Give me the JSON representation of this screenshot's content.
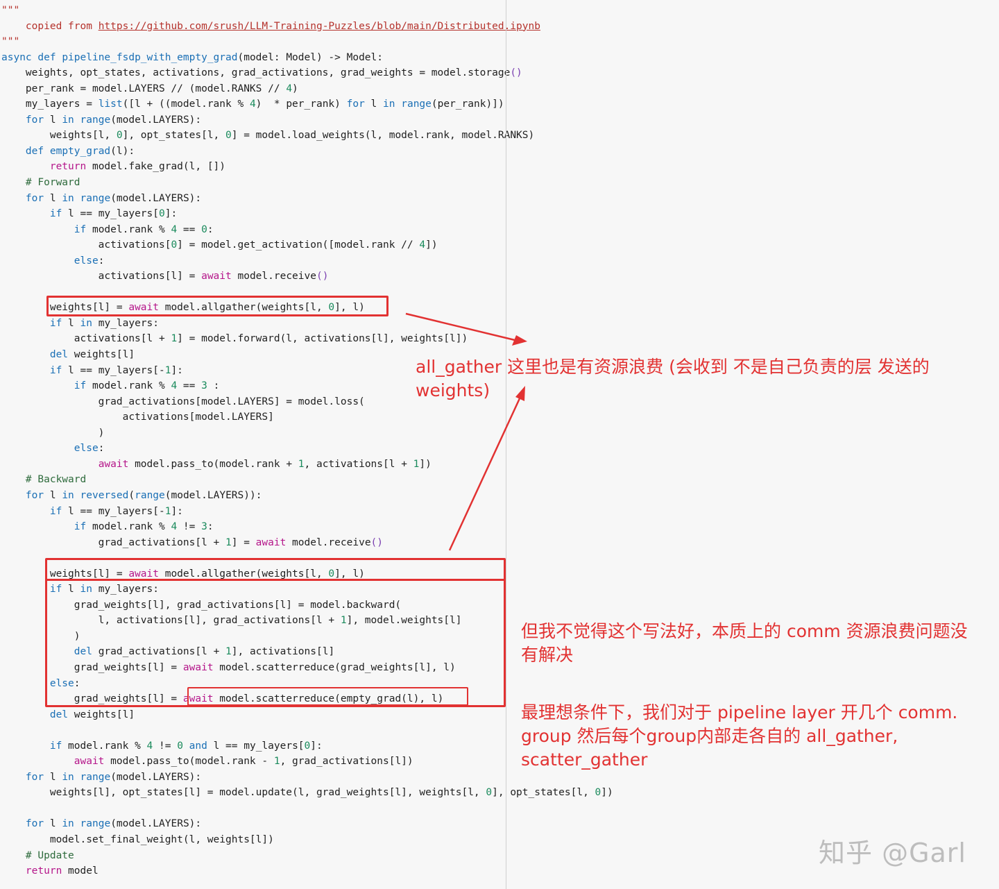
{
  "code": {
    "lines": [
      [
        {
          "t": "\"\"\"",
          "c": "s"
        }
      ],
      [
        {
          "t": "    copied from ",
          "c": "s"
        },
        {
          "t": "https://github.com/srush/LLM-Training-Puzzles/blob/main/Distributed.ipynb",
          "c": "u"
        }
      ],
      [
        {
          "t": "\"\"\"",
          "c": "s"
        }
      ],
      [
        {
          "t": "async def",
          "c": "k"
        },
        {
          "t": " ",
          "c": "x"
        },
        {
          "t": "pipeline_fsdp_with_empty_grad",
          "c": "f"
        },
        {
          "t": "(model: Model) -> Model:",
          "c": "x"
        }
      ],
      [
        {
          "t": "    weights, opt_states, activations, grad_activations, grad_weights = model.storage",
          "c": "x"
        },
        {
          "t": "()",
          "c": "p"
        }
      ],
      [
        {
          "t": "    per_rank = model.LAYERS // (model.RANKS // ",
          "c": "x"
        },
        {
          "t": "4",
          "c": "n"
        },
        {
          "t": ")",
          "c": "x"
        }
      ],
      [
        {
          "t": "    my_layers = ",
          "c": "x"
        },
        {
          "t": "list",
          "c": "b"
        },
        {
          "t": "([l + ((model.rank % ",
          "c": "x"
        },
        {
          "t": "4",
          "c": "n"
        },
        {
          "t": ")  * per_rank) ",
          "c": "x"
        },
        {
          "t": "for",
          "c": "k"
        },
        {
          "t": " l ",
          "c": "x"
        },
        {
          "t": "in",
          "c": "k"
        },
        {
          "t": " ",
          "c": "x"
        },
        {
          "t": "range",
          "c": "b"
        },
        {
          "t": "(per_rank)])",
          "c": "x"
        }
      ],
      [
        {
          "t": "    ",
          "c": "x"
        },
        {
          "t": "for",
          "c": "k"
        },
        {
          "t": " l ",
          "c": "x"
        },
        {
          "t": "in",
          "c": "k"
        },
        {
          "t": " ",
          "c": "x"
        },
        {
          "t": "range",
          "c": "b"
        },
        {
          "t": "(model.LAYERS):",
          "c": "x"
        }
      ],
      [
        {
          "t": "        weights[l, ",
          "c": "x"
        },
        {
          "t": "0",
          "c": "n"
        },
        {
          "t": "], opt_states[l, ",
          "c": "x"
        },
        {
          "t": "0",
          "c": "n"
        },
        {
          "t": "] = model.load_weights(l, model.rank, model.RANKS)",
          "c": "x"
        }
      ],
      [
        {
          "t": "    ",
          "c": "x"
        },
        {
          "t": "def",
          "c": "k"
        },
        {
          "t": " ",
          "c": "x"
        },
        {
          "t": "empty_grad",
          "c": "f"
        },
        {
          "t": "(l):",
          "c": "x"
        }
      ],
      [
        {
          "t": "        ",
          "c": "x"
        },
        {
          "t": "return",
          "c": "m"
        },
        {
          "t": " model.fake_grad(l, [])",
          "c": "x"
        }
      ],
      [
        {
          "t": "    # Forward",
          "c": "c"
        }
      ],
      [
        {
          "t": "    ",
          "c": "x"
        },
        {
          "t": "for",
          "c": "k"
        },
        {
          "t": " l ",
          "c": "x"
        },
        {
          "t": "in",
          "c": "k"
        },
        {
          "t": " ",
          "c": "x"
        },
        {
          "t": "range",
          "c": "b"
        },
        {
          "t": "(model.LAYERS):",
          "c": "x"
        }
      ],
      [
        {
          "t": "        ",
          "c": "x"
        },
        {
          "t": "if",
          "c": "k"
        },
        {
          "t": " l == my_layers[",
          "c": "x"
        },
        {
          "t": "0",
          "c": "n"
        },
        {
          "t": "]:",
          "c": "x"
        }
      ],
      [
        {
          "t": "            ",
          "c": "x"
        },
        {
          "t": "if",
          "c": "k"
        },
        {
          "t": " model.rank % ",
          "c": "x"
        },
        {
          "t": "4",
          "c": "n"
        },
        {
          "t": " == ",
          "c": "x"
        },
        {
          "t": "0",
          "c": "n"
        },
        {
          "t": ":",
          "c": "x"
        }
      ],
      [
        {
          "t": "                activations[",
          "c": "x"
        },
        {
          "t": "0",
          "c": "n"
        },
        {
          "t": "] = model.get_activation([model.rank // ",
          "c": "x"
        },
        {
          "t": "4",
          "c": "n"
        },
        {
          "t": "])",
          "c": "x"
        }
      ],
      [
        {
          "t": "            ",
          "c": "x"
        },
        {
          "t": "else",
          "c": "k"
        },
        {
          "t": ":",
          "c": "x"
        }
      ],
      [
        {
          "t": "                activations[l] = ",
          "c": "x"
        },
        {
          "t": "await",
          "c": "m"
        },
        {
          "t": " model.receive",
          "c": "x"
        },
        {
          "t": "()",
          "c": "p"
        }
      ],
      [
        {
          "t": "",
          "c": "x"
        }
      ],
      [
        {
          "t": "        weights[l] = ",
          "c": "x"
        },
        {
          "t": "await",
          "c": "m"
        },
        {
          "t": " model.allgather(weights[l, ",
          "c": "x"
        },
        {
          "t": "0",
          "c": "n"
        },
        {
          "t": "], l)",
          "c": "x"
        }
      ],
      [
        {
          "t": "        ",
          "c": "x"
        },
        {
          "t": "if",
          "c": "k"
        },
        {
          "t": " l ",
          "c": "x"
        },
        {
          "t": "in",
          "c": "k"
        },
        {
          "t": " my_layers:",
          "c": "x"
        }
      ],
      [
        {
          "t": "            activations[l + ",
          "c": "x"
        },
        {
          "t": "1",
          "c": "n"
        },
        {
          "t": "] = model.forward(l, activations[l], weights[l])",
          "c": "x"
        }
      ],
      [
        {
          "t": "        ",
          "c": "x"
        },
        {
          "t": "del",
          "c": "k"
        },
        {
          "t": " weights[l]",
          "c": "x"
        }
      ],
      [
        {
          "t": "        ",
          "c": "x"
        },
        {
          "t": "if",
          "c": "k"
        },
        {
          "t": " l == my_layers[-",
          "c": "x"
        },
        {
          "t": "1",
          "c": "n"
        },
        {
          "t": "]:",
          "c": "x"
        }
      ],
      [
        {
          "t": "            ",
          "c": "x"
        },
        {
          "t": "if",
          "c": "k"
        },
        {
          "t": " model.rank % ",
          "c": "x"
        },
        {
          "t": "4",
          "c": "n"
        },
        {
          "t": " == ",
          "c": "x"
        },
        {
          "t": "3",
          "c": "n"
        },
        {
          "t": " :",
          "c": "x"
        }
      ],
      [
        {
          "t": "                grad_activations[model.LAYERS] = model.loss(",
          "c": "x"
        }
      ],
      [
        {
          "t": "                    activations[model.LAYERS]",
          "c": "x"
        }
      ],
      [
        {
          "t": "                )",
          "c": "x"
        }
      ],
      [
        {
          "t": "            ",
          "c": "x"
        },
        {
          "t": "else",
          "c": "k"
        },
        {
          "t": ":",
          "c": "x"
        }
      ],
      [
        {
          "t": "                ",
          "c": "x"
        },
        {
          "t": "await",
          "c": "m"
        },
        {
          "t": " model.pass_to(model.rank + ",
          "c": "x"
        },
        {
          "t": "1",
          "c": "n"
        },
        {
          "t": ", activations[l + ",
          "c": "x"
        },
        {
          "t": "1",
          "c": "n"
        },
        {
          "t": "])",
          "c": "x"
        }
      ],
      [
        {
          "t": "    # Backward",
          "c": "c"
        }
      ],
      [
        {
          "t": "    ",
          "c": "x"
        },
        {
          "t": "for",
          "c": "k"
        },
        {
          "t": " l ",
          "c": "x"
        },
        {
          "t": "in",
          "c": "k"
        },
        {
          "t": " ",
          "c": "x"
        },
        {
          "t": "reversed",
          "c": "b"
        },
        {
          "t": "(",
          "c": "x"
        },
        {
          "t": "range",
          "c": "b"
        },
        {
          "t": "(model.LAYERS)):",
          "c": "x"
        }
      ],
      [
        {
          "t": "        ",
          "c": "x"
        },
        {
          "t": "if",
          "c": "k"
        },
        {
          "t": " l == my_layers[-",
          "c": "x"
        },
        {
          "t": "1",
          "c": "n"
        },
        {
          "t": "]:",
          "c": "x"
        }
      ],
      [
        {
          "t": "            ",
          "c": "x"
        },
        {
          "t": "if",
          "c": "k"
        },
        {
          "t": " model.rank % ",
          "c": "x"
        },
        {
          "t": "4",
          "c": "n"
        },
        {
          "t": " != ",
          "c": "x"
        },
        {
          "t": "3",
          "c": "n"
        },
        {
          "t": ":",
          "c": "x"
        }
      ],
      [
        {
          "t": "                grad_activations[l + ",
          "c": "x"
        },
        {
          "t": "1",
          "c": "n"
        },
        {
          "t": "] = ",
          "c": "x"
        },
        {
          "t": "await",
          "c": "m"
        },
        {
          "t": " model.receive",
          "c": "x"
        },
        {
          "t": "()",
          "c": "p"
        }
      ],
      [
        {
          "t": "",
          "c": "x"
        }
      ],
      [
        {
          "t": "        weights[l] = ",
          "c": "x"
        },
        {
          "t": "await",
          "c": "m"
        },
        {
          "t": " model.allgather(weights[l, ",
          "c": "x"
        },
        {
          "t": "0",
          "c": "n"
        },
        {
          "t": "], l)",
          "c": "x"
        }
      ],
      [
        {
          "t": "        ",
          "c": "x"
        },
        {
          "t": "if",
          "c": "k"
        },
        {
          "t": " l ",
          "c": "x"
        },
        {
          "t": "in",
          "c": "k"
        },
        {
          "t": " my_layers:",
          "c": "x"
        }
      ],
      [
        {
          "t": "            grad_weights[l], grad_activations[l] = model.backward(",
          "c": "x"
        }
      ],
      [
        {
          "t": "                l, activations[l], grad_activations[l + ",
          "c": "x"
        },
        {
          "t": "1",
          "c": "n"
        },
        {
          "t": "], model.weights[l]",
          "c": "x"
        }
      ],
      [
        {
          "t": "            )",
          "c": "x"
        }
      ],
      [
        {
          "t": "            ",
          "c": "x"
        },
        {
          "t": "del",
          "c": "k"
        },
        {
          "t": " grad_activations[l + ",
          "c": "x"
        },
        {
          "t": "1",
          "c": "n"
        },
        {
          "t": "], activations[l]",
          "c": "x"
        }
      ],
      [
        {
          "t": "            grad_weights[l] = ",
          "c": "x"
        },
        {
          "t": "await",
          "c": "m"
        },
        {
          "t": " model.scatterreduce(grad_weights[l], l)",
          "c": "x"
        }
      ],
      [
        {
          "t": "        ",
          "c": "x"
        },
        {
          "t": "else",
          "c": "k"
        },
        {
          "t": ":",
          "c": "x"
        }
      ],
      [
        {
          "t": "            grad_weights[l] = ",
          "c": "x"
        },
        {
          "t": "await",
          "c": "m"
        },
        {
          "t": " model.scatterreduce(empty_grad(l), l)",
          "c": "x"
        }
      ],
      [
        {
          "t": "        ",
          "c": "x"
        },
        {
          "t": "del",
          "c": "k"
        },
        {
          "t": " weights[l]",
          "c": "x"
        }
      ],
      [
        {
          "t": "",
          "c": "x"
        }
      ],
      [
        {
          "t": "        ",
          "c": "x"
        },
        {
          "t": "if",
          "c": "k"
        },
        {
          "t": " model.rank % ",
          "c": "x"
        },
        {
          "t": "4",
          "c": "n"
        },
        {
          "t": " != ",
          "c": "x"
        },
        {
          "t": "0",
          "c": "n"
        },
        {
          "t": " ",
          "c": "x"
        },
        {
          "t": "and",
          "c": "k"
        },
        {
          "t": " l == my_layers[",
          "c": "x"
        },
        {
          "t": "0",
          "c": "n"
        },
        {
          "t": "]:",
          "c": "x"
        }
      ],
      [
        {
          "t": "            ",
          "c": "x"
        },
        {
          "t": "await",
          "c": "m"
        },
        {
          "t": " model.pass_to(model.rank - ",
          "c": "x"
        },
        {
          "t": "1",
          "c": "n"
        },
        {
          "t": ", grad_activations[l])",
          "c": "x"
        }
      ],
      [
        {
          "t": "    ",
          "c": "x"
        },
        {
          "t": "for",
          "c": "k"
        },
        {
          "t": " l ",
          "c": "x"
        },
        {
          "t": "in",
          "c": "k"
        },
        {
          "t": " ",
          "c": "x"
        },
        {
          "t": "range",
          "c": "b"
        },
        {
          "t": "(model.LAYERS):",
          "c": "x"
        }
      ],
      [
        {
          "t": "        weights[l], opt_states[l] = model.update(l, grad_weights[l], weights[l, ",
          "c": "x"
        },
        {
          "t": "0",
          "c": "n"
        },
        {
          "t": "], opt_states[l, ",
          "c": "x"
        },
        {
          "t": "0",
          "c": "n"
        },
        {
          "t": "])",
          "c": "x"
        }
      ],
      [
        {
          "t": "",
          "c": "x"
        }
      ],
      [
        {
          "t": "    ",
          "c": "x"
        },
        {
          "t": "for",
          "c": "k"
        },
        {
          "t": " l ",
          "c": "x"
        },
        {
          "t": "in",
          "c": "k"
        },
        {
          "t": " ",
          "c": "x"
        },
        {
          "t": "range",
          "c": "b"
        },
        {
          "t": "(model.LAYERS):",
          "c": "x"
        }
      ],
      [
        {
          "t": "        model.set_final_weight(l, weights[l])",
          "c": "x"
        }
      ],
      [
        {
          "t": "    # Update",
          "c": "c"
        }
      ],
      [
        {
          "t": "    ",
          "c": "x"
        },
        {
          "t": "return",
          "c": "m"
        },
        {
          "t": " model",
          "c": "x"
        }
      ]
    ]
  },
  "annotations": {
    "note_allgather": {
      "line1": "all_gather 这里也是有资源浪费 (会收到 不是自己负责的层 发送的",
      "line2": "weights)"
    },
    "note_style": {
      "line1": "但我不觉得这个写法好，本质上的 comm 资源浪费问题没",
      "line2": "有解决"
    },
    "note_ideal": {
      "line1": "最理想条件下，我们对于 pipeline layer 开几个 comm.",
      "line2": "group 然后每个group内部走各自的 all_gather,",
      "line3": "scatter_gather"
    },
    "color": "#e23232"
  },
  "watermark": {
    "text": "知乎 @Garl"
  }
}
